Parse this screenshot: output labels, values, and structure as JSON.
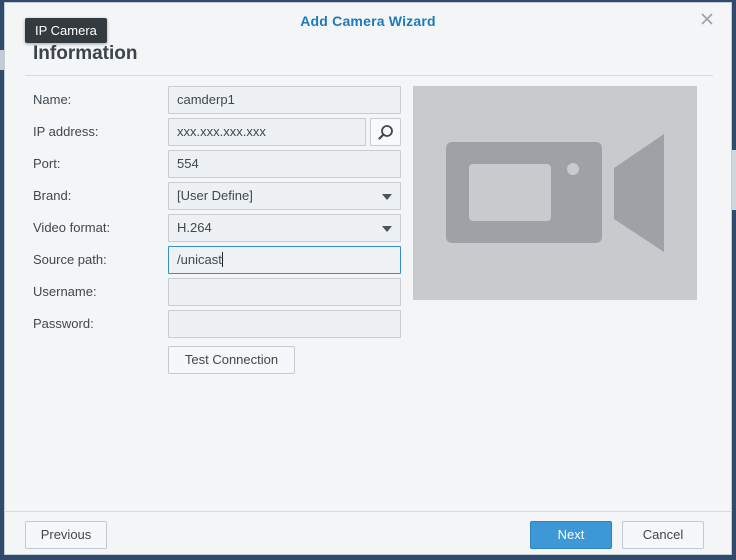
{
  "wizard": {
    "title": "Add Camera Wizard"
  },
  "tooltip": {
    "text": "IP Camera"
  },
  "section": {
    "title": "Information"
  },
  "form": {
    "name": {
      "label": "Name:",
      "value": "camderp1"
    },
    "ip": {
      "label": "IP address:",
      "value": "xxx.xxx.xxx.xxx"
    },
    "port": {
      "label": "Port:",
      "value": "554"
    },
    "brand": {
      "label": "Brand:",
      "value": "[User Define]"
    },
    "video_format": {
      "label": "Video format:",
      "value": "H.264"
    },
    "source_path": {
      "label": "Source path:",
      "value": "/unicast"
    },
    "username": {
      "label": "Username:",
      "value": ""
    },
    "password": {
      "label": "Password:",
      "value": ""
    },
    "test_connection_label": "Test Connection"
  },
  "footer": {
    "previous_label": "Previous",
    "next_label": "Next",
    "cancel_label": "Cancel"
  },
  "icons": {
    "close": "close-icon",
    "search": "search-icon",
    "dropdown": "chevron-down-icon",
    "camera": "video-camera-icon"
  },
  "colors": {
    "accent": "#1b7bb8",
    "primary_button": "#3c98d6",
    "preview_bg": "#c8cbce",
    "camera_glyph": "#9ea2a6"
  }
}
